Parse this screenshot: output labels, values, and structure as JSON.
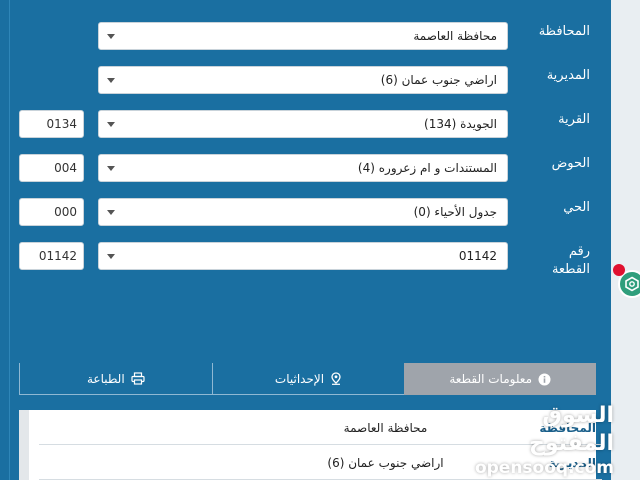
{
  "form": {
    "fields": [
      {
        "label": "المحافظة",
        "value": "محافظة العاصمة",
        "code": ""
      },
      {
        "label": "المديرية",
        "value": "اراضي جنوب عمان (6)",
        "code": ""
      },
      {
        "label": "القرية",
        "value": "الجويدة (134)",
        "code": "0134"
      },
      {
        "label": "الحوض",
        "value": "المستندات و ام زعروره (4)",
        "code": "004"
      },
      {
        "label": "الحي",
        "value": "جدول الأحياء (0)",
        "code": "000"
      },
      {
        "label": "رقم القطعة",
        "value": "01142",
        "code": "01142"
      }
    ]
  },
  "tabs": [
    {
      "label": "معلومات القطعة",
      "icon": "info-icon"
    },
    {
      "label": "الإحداثيات",
      "icon": "location-pin-icon"
    },
    {
      "label": "الطباعة",
      "icon": "printer-icon"
    }
  ],
  "info": {
    "rows": [
      {
        "key": "المحافظة",
        "value": "محافظة العاصمة"
      },
      {
        "key": "المديرية",
        "value": "اراضي جنوب عمان (6)"
      }
    ]
  },
  "watermark": {
    "arabic": "السوق المفتوح",
    "latin": "opensooq.com"
  },
  "colors": {
    "background": "#1a6fa1",
    "active_tab": "#9fa4ab",
    "fab": "#2f9e7c",
    "badge": "#e0102f"
  }
}
